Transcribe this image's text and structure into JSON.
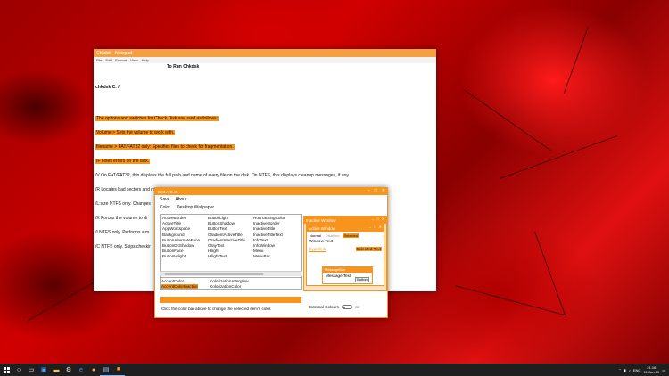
{
  "notepad": {
    "title": "Chkdsk - Notepad",
    "menu": [
      "File",
      "Edit",
      "Format",
      "View",
      "Help"
    ],
    "lines": [
      {
        "text": "To Run Chkdsk",
        "highlight": false
      },
      {
        "text": "chkdsk C: /r",
        "highlight": false
      },
      {
        "text": "The options and switches for Check Disk are used as follows:",
        "highlight": true
      },
      {
        "text": "Volume > Sets the volume to work with.",
        "highlight": true
      },
      {
        "text": "filename > FAT/FAT32 only: Specifies files to check for fragmentation.",
        "highlight": true
      },
      {
        "text": "/F Fixes errors on the disk.",
        "highlight": true
      },
      {
        "text": "/V On FAT/FAT32, this displays the full path and name of every file on the disk. On NTFS, this displays cleanup messages, if any.",
        "highlight": false
      },
      {
        "text": "/R Locates bad sectors and recovers readable information (implies /F).",
        "highlight": false
      },
      {
        "text": "/L:size NTFS only. Changes",
        "highlight": false
      },
      {
        "text": "/X Forces the volume to di",
        "highlight": false
      },
      {
        "text": "/I NTFS only. Performs a m",
        "highlight": false
      },
      {
        "text": "/C NTFS only. Skips checkir",
        "highlight": false
      }
    ]
  },
  "smacc": {
    "title": "S.M.A.C.C.",
    "menu": [
      "Save",
      "About"
    ],
    "tabs": [
      "Color",
      "Desktop Wallpaper"
    ],
    "color_columns": [
      [
        "ActiveBorder",
        "ActiveTitle",
        "AppWorkspace",
        "Background",
        "ButtonAlternateFace",
        "ButtonDkShadow",
        "ButtonFace",
        "ButtonHilight"
      ],
      [
        "ButtonLight",
        "ButtonShadow",
        "ButtonText",
        "GradientActiveTitle",
        "GradientInactiveTitle",
        "GrayText",
        "Hilight",
        "HilightText"
      ],
      [
        "HotTrackingColor",
        "InactiveBorder",
        "InactiveTitle",
        "InactiveTitleText",
        "InfoText",
        "InfoWindow",
        "Menu",
        "MenuBar"
      ]
    ],
    "accent_colors": [
      {
        "label": "AccentColor",
        "selected": false
      },
      {
        "label": "ColorizationAfterglow",
        "selected": false
      },
      {
        "label": "AccentColorInactive",
        "selected": true
      },
      {
        "label": "ColorizationColor",
        "selected": false
      }
    ],
    "hint": "Click the color bar above to change the selected item's color.",
    "accent_hex": "#f7941d",
    "preview": {
      "inactive_title": "Inactive Window",
      "active_title": "Active Window",
      "states": [
        "Normal",
        "Disabled",
        "Selected"
      ],
      "window_text": "Window Text",
      "hyperlink": "Hyperlink",
      "selected_text": "Selected Text",
      "msgbox_title": "MessageBox",
      "msg_text": "Message Text",
      "button": "Button"
    },
    "external_colours": "External Colours",
    "toggle_state": "Off"
  },
  "taskbar": {
    "time": "21:16",
    "date": "11-Jan-19",
    "lang": "ENG"
  }
}
